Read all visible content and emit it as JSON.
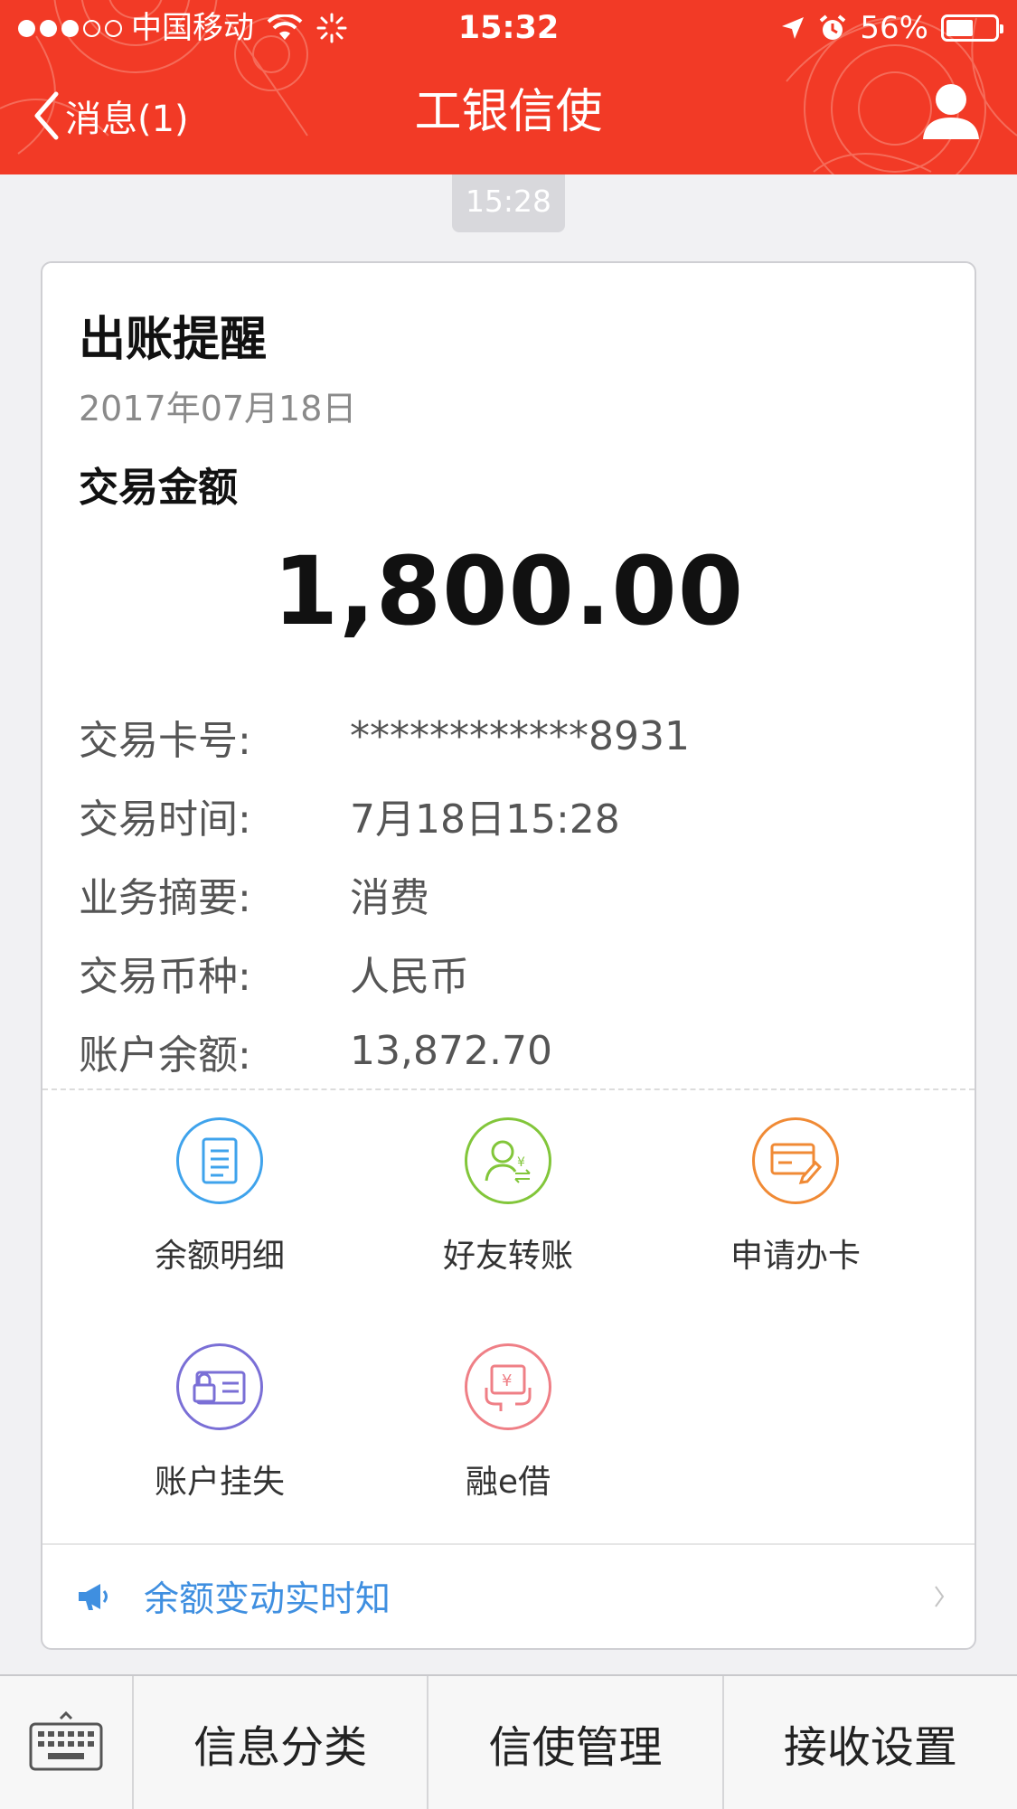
{
  "status_bar": {
    "carrier": "中国移动",
    "time": "15:32",
    "battery": "56%",
    "battery_level": 0.56
  },
  "navbar": {
    "back_label": "消息(1)",
    "title": "工银信使"
  },
  "timestamp": "15:28",
  "card": {
    "title": "出账提醒",
    "date": "2017年07月18日",
    "amount_label": "交易金额",
    "amount": "1,800.00",
    "details": [
      {
        "label": "交易卡号:",
        "value": "************8931"
      },
      {
        "label": "交易时间:",
        "value": "7月18日15:28"
      },
      {
        "label": "业务摘要:",
        "value": "消费"
      },
      {
        "label": "交易币种:",
        "value": "人民币"
      },
      {
        "label": "账户余额:",
        "value": "13,872.70"
      }
    ],
    "actions": [
      {
        "label": "余额明细",
        "icon": "document-icon",
        "color": "#3fa3ec"
      },
      {
        "label": "好友转账",
        "icon": "transfer-user-icon",
        "color": "#82c63a"
      },
      {
        "label": "申请办卡",
        "icon": "card-apply-icon",
        "color": "#f08a35"
      },
      {
        "label": "账户挂失",
        "icon": "card-lock-icon",
        "color": "#7a6fd6"
      },
      {
        "label": "融e借",
        "icon": "loan-icon",
        "color": "#ef7f86"
      }
    ],
    "notice": "余额变动实时知"
  },
  "bottom_bar": {
    "buttons": [
      "信息分类",
      "信使管理",
      "接收设置"
    ]
  },
  "colors": {
    "header_red": "#f23a26",
    "link_blue": "#3f8fe0"
  }
}
